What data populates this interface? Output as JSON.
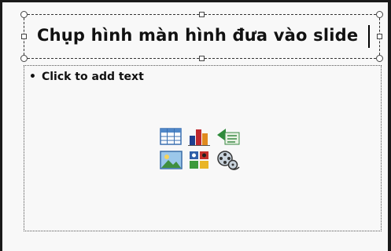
{
  "slide": {
    "title": "Chụp hình màn hình đưa vào slide",
    "content_placeholder": "Click to add text",
    "content_icons": [
      {
        "name": "insert-table-icon"
      },
      {
        "name": "insert-chart-icon"
      },
      {
        "name": "insert-smartart-icon"
      },
      {
        "name": "insert-picture-icon"
      },
      {
        "name": "insert-clip-art-icon"
      },
      {
        "name": "insert-media-icon"
      }
    ]
  }
}
